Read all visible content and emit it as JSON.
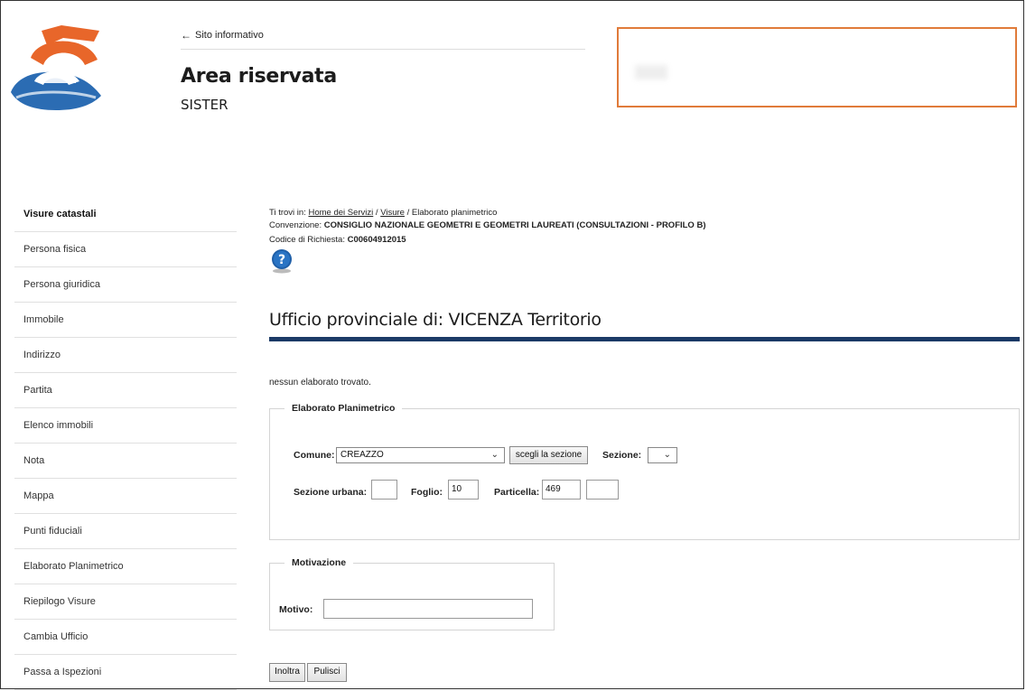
{
  "header": {
    "back_link": "Sito informativo",
    "title": "Area riservata",
    "subtitle": "SISTER"
  },
  "sidebar": {
    "heading": "Visure catastali",
    "items": [
      {
        "label": "Persona fisica"
      },
      {
        "label": "Persona giuridica"
      },
      {
        "label": "Immobile"
      },
      {
        "label": "Indirizzo"
      },
      {
        "label": "Partita"
      },
      {
        "label": "Elenco immobili"
      },
      {
        "label": "Nota"
      },
      {
        "label": "Mappa"
      },
      {
        "label": "Punti fiduciali"
      },
      {
        "label": "Elaborato Planimetrico"
      },
      {
        "label": "Riepilogo Visure"
      },
      {
        "label": "Cambia Ufficio"
      },
      {
        "label": "Passa a Ispezioni"
      }
    ]
  },
  "breadcrumb": {
    "prefix": "Ti trovi in:",
    "home": "Home dei Servizi",
    "sep1": "/",
    "visure": "Visure",
    "sep2": "/",
    "current": "Elaborato planimetrico"
  },
  "convenzione": {
    "label": "Convenzione:",
    "value": "CONSIGLIO NAZIONALE GEOMETRI E GEOMETRI LAUREATI (CONSULTAZIONI - PROFILO B)"
  },
  "codice": {
    "label": "Codice di Richiesta:",
    "value": "C00604912015"
  },
  "office_title": "Ufficio provinciale di: VICENZA Territorio",
  "message": "nessun elaborato trovato.",
  "elaborato": {
    "legend": "Elaborato Planimetrico",
    "comune_label": "Comune:",
    "comune_value": "CREAZZO",
    "sezione_button": "scegli la sezione",
    "sezione_label": "Sezione:",
    "sezione_value": "",
    "sezione_urbana_label": "Sezione urbana:",
    "sezione_urbana_value": "",
    "foglio_label": "Foglio:",
    "foglio_value": "10",
    "particella_label": "Particella:",
    "particella_value": "469",
    "subalterno_value": ""
  },
  "motivazione": {
    "legend": "Motivazione",
    "motivo_label": "Motivo:",
    "motivo_value": ""
  },
  "buttons": {
    "inoltra": "Inoltra",
    "pulisci": "Pulisci"
  },
  "colors": {
    "accent_bar": "#1b3a66",
    "user_box_border": "#e07b3a",
    "logo_orange": "#e8662a",
    "logo_blue": "#2b6cb3"
  }
}
